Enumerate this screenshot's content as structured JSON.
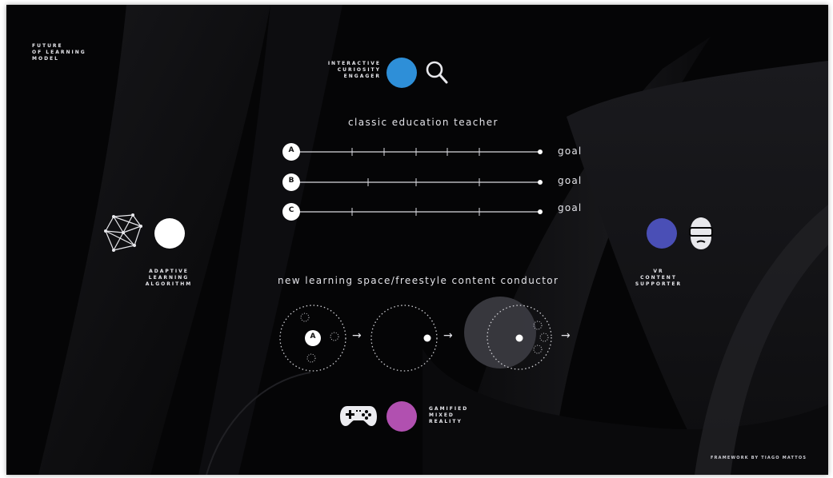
{
  "corner_title": {
    "line1": "FUTURE",
    "line2": "OF LEARNING",
    "line3": "MODEL"
  },
  "curiosity": {
    "line1": "INTERACTIVE",
    "line2": "CURIOSITY",
    "line3": "ENGAGER",
    "color": "#2e8fd8",
    "icon": "magnifier-icon"
  },
  "classic": {
    "title": "classic education teacher",
    "tracks": [
      {
        "badge": "A",
        "goal": "goal"
      },
      {
        "badge": "B",
        "goal": "goal"
      },
      {
        "badge": "C",
        "goal": "goal"
      }
    ]
  },
  "adaptive": {
    "line1": "ADAPTIVE",
    "line2": "LEARNING",
    "line3": "ALGORITHM",
    "color": "#ffffff",
    "icon": "polyhedron-icon"
  },
  "vr": {
    "line1": "VR",
    "line2": "CONTENT",
    "line3": "SUPPORTER",
    "color": "#4a4fb6",
    "icon": "vr-headset-icon"
  },
  "new_space": {
    "title": "new learning space/freestyle content conductor",
    "badge": "A",
    "arrow": "→"
  },
  "gamified": {
    "line1": "GAMIFIED",
    "line2": "MIXED",
    "line3": "REALITY",
    "color": "#b150b0",
    "icon": "gamepad-icon"
  },
  "credit": "FRAMEWORK BY TIAGO MATTOS"
}
